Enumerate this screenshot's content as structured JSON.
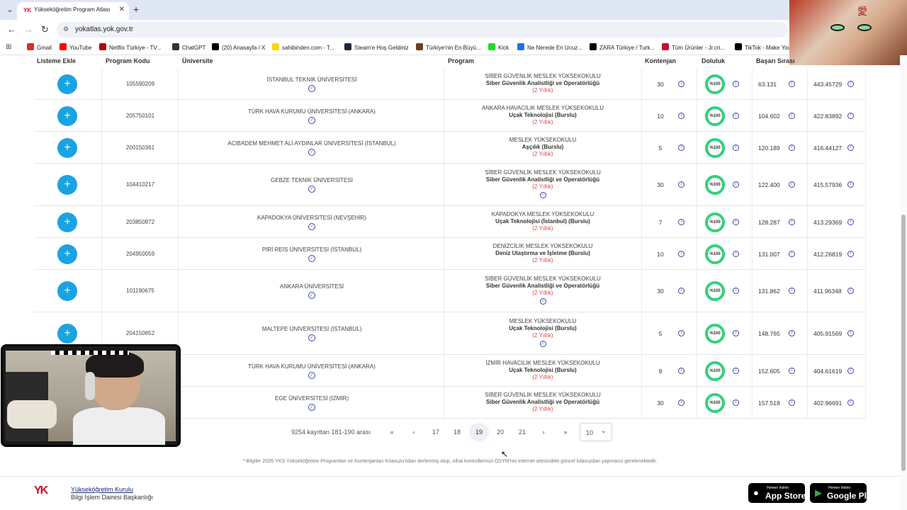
{
  "browser": {
    "tab_title": "Yükseköğretim Program Atlası",
    "url": "yokatlas.yok.gov.tr",
    "bookmarks": [
      {
        "label": "Gmail",
        "color": "#d93025"
      },
      {
        "label": "YouTube",
        "color": "#ff0000"
      },
      {
        "label": "Netflix Türkiye - TV...",
        "color": "#b20710"
      },
      {
        "label": "ChatGPT",
        "color": "#333333"
      },
      {
        "label": "(20) Anasayfa / X",
        "color": "#000000"
      },
      {
        "label": "sahibinden.com - T...",
        "color": "#ffd400"
      },
      {
        "label": "Steam'e Hoş Geldiniz",
        "color": "#1b2838"
      },
      {
        "label": "Türkiye'nin En Büyü...",
        "color": "#6b3d1e"
      },
      {
        "label": "Kick",
        "color": "#1fdd24"
      },
      {
        "label": "Ne Nerede En Ucuz...",
        "color": "#1a73e8"
      },
      {
        "label": "ZARA Türkiye / Turk...",
        "color": "#000000"
      },
      {
        "label": "Tüm Ürünler - Jr.cri...",
        "color": "#c8102e"
      },
      {
        "label": "TikTok - Make You",
        "color": "#000000"
      }
    ]
  },
  "table": {
    "headers": {
      "add": "Listeme Ekle",
      "code": "Program Kodu",
      "university": "Üniversite",
      "program": "Program",
      "quota": "Kontenjan",
      "fill": "Doluluk",
      "rank": "Başarı Sırası"
    },
    "rows": [
      {
        "code": "105590209",
        "university": "İSTANBUL TEKNİK ÜNİVERSİTESİ",
        "school": "SİBER GÜVENLİK MESLEK YÜKSEKOKULU",
        "program": "Siber Güvenlik Analistliği ve Operatörlüğü",
        "duration": "(2 Yıllık)",
        "extra_info": false,
        "quota": "30",
        "fill": "%100",
        "rank": "63.131",
        "score": "443.45729"
      },
      {
        "code": "205750101",
        "university": "TÜRK HAVA KURUMU ÜNİVERSİTESİ (ANKARA)",
        "school": "ANKARA HAVACILIK MESLEK YÜKSEKOKULU",
        "program": "Uçak Teknolojisi (Burslu)",
        "duration": "(2 Yıllık)",
        "extra_info": false,
        "quota": "10",
        "fill": "%100",
        "rank": "104.602",
        "score": "422.83892"
      },
      {
        "code": "200150361",
        "university": "ACIBADEM MEHMET ALİ AYDINLAR ÜNİVERSİTESİ (İSTANBUL)",
        "school": "MESLEK YÜKSEKOKULU",
        "program": "Aşçılık (Burslu)",
        "duration": "(2 Yıllık)",
        "extra_info": false,
        "quota": "5",
        "fill": "%100",
        "rank": "120.189",
        "score": "416.44127"
      },
      {
        "code": "104410217",
        "university": "GEBZE TEKNİK ÜNİVERSİTESİ",
        "school": "SİBER GÜVENLİK MESLEK YÜKSEKOKULU",
        "program": "Siber Güvenlik Analistliği ve Operatörlüğü",
        "duration": "(2 Yıllık)",
        "extra_info": true,
        "quota": "30",
        "fill": "%100",
        "rank": "122.400",
        "score": "415.57936"
      },
      {
        "code": "203850972",
        "university": "KAPADOKYA ÜNİVERSİTESİ (NEVŞEHİR)",
        "school": "KAPADOKYA MESLEK YÜKSEKOKULU",
        "program": "Uçak Teknolojisi (İstanbul) (Burslu)",
        "duration": "(2 Yıllık)",
        "extra_info": false,
        "quota": "7",
        "fill": "%100",
        "rank": "128.287",
        "score": "413.29369"
      },
      {
        "code": "204950059",
        "university": "PİRİ REİS ÜNİVERSİTESİ (İSTANBUL)",
        "school": "DENİZCİLİK MESLEK YÜKSEKOKULU",
        "program": "Deniz Ulaştırma ve İşletme (Burslu)",
        "duration": "(2 Yıllık)",
        "extra_info": false,
        "quota": "10",
        "fill": "%100",
        "rank": "131.007",
        "score": "412.26819"
      },
      {
        "code": "101190675",
        "university": "ANKARA ÜNİVERSİTESİ",
        "school": "SİBER GÜVENLİK MESLEK YÜKSEKOKULU",
        "program": "Siber Güvenlik Analistliği ve Operatörlüğü",
        "duration": "(2 Yıllık)",
        "extra_info": true,
        "quota": "30",
        "fill": "%100",
        "rank": "131.862",
        "score": "411.96348"
      },
      {
        "code": "204150852",
        "university": "MALTEPE ÜNİVERSİTESİ (İSTANBUL)",
        "school": "MESLEK YÜKSEKOKULU",
        "program": "Uçak Teknolojisi (Burslu)",
        "duration": "(2 Yıllık)",
        "extra_info": true,
        "quota": "5",
        "fill": "%100",
        "rank": "148.765",
        "score": "405.91569"
      },
      {
        "code": "",
        "university": "TÜRK HAVA KURUMU ÜNİVERSİTESİ (ANKARA)",
        "school": "İZMİR HAVACILIK MESLEK YÜKSEKOKULU",
        "program": "Uçak Teknolojisi (Burslu)",
        "duration": "(2 Yıllık)",
        "extra_info": false,
        "quota": "9",
        "fill": "%100",
        "rank": "152.605",
        "score": "404.61619"
      },
      {
        "code": "",
        "university": "EGE ÜNİVERSİTESİ (İZMİR)",
        "school": "SİBER GÜVENLİK MESLEK YÜKSEKOKULU",
        "program": "Siber Güvenlik Analistliği ve Operatörlüğü",
        "duration": "(2 Yıllık)",
        "extra_info": false,
        "quota": "30",
        "fill": "%100",
        "rank": "157.518",
        "score": "402.96691"
      }
    ]
  },
  "pagination": {
    "info": "9254 kayıttan 181-190 arası",
    "pages": [
      "17",
      "18",
      "19",
      "20",
      "21"
    ],
    "current": "19",
    "page_size": "10"
  },
  "note": "* Bilgiler 2026-YKS Yükseköğretim Programları ve Kontenjanları Kılavuzu'ndan derlenmiş olup, nihai kontrollerinizi ÖSYM'nin internet sitesindeki güncel kılavuzdan yapmanız gerekmektedir.",
  "footer": {
    "org_name": "Yükseköğretim Kurulu",
    "dept": "Bilgi İşlem Dairesi Başkanlığı",
    "appstore_small": "Hemen İndirin",
    "appstore_big": "App Store",
    "playstore_small": "Hemen İndirin",
    "playstore_big": "Google Play"
  }
}
